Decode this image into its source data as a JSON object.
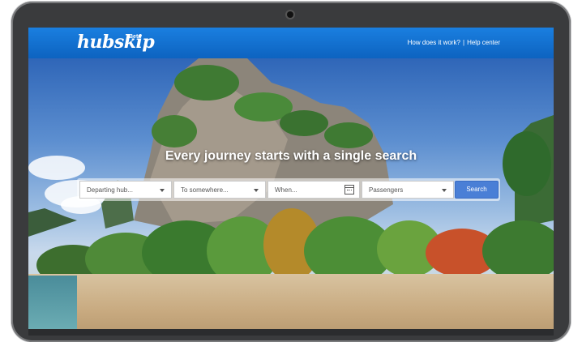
{
  "header": {
    "logo": "hubskip",
    "beta": "Beta",
    "nav": {
      "how_it_works": "How does it work?",
      "separator": "|",
      "help_center": "Help center"
    }
  },
  "hero": {
    "headline": "Every journey starts with a single search"
  },
  "search": {
    "departing": "Departing hub...",
    "destination": "To somewhere...",
    "when": "When...",
    "passengers": "Passengers",
    "button": "Search"
  },
  "icons": {
    "departing_dropdown": "chevron-down-icon",
    "destination_dropdown": "chevron-down-icon",
    "date_picker": "calendar-icon",
    "passengers_dropdown": "chevron-down-icon"
  },
  "colors": {
    "header": "#1a7fe0",
    "search_button": "#4a7fd6"
  }
}
